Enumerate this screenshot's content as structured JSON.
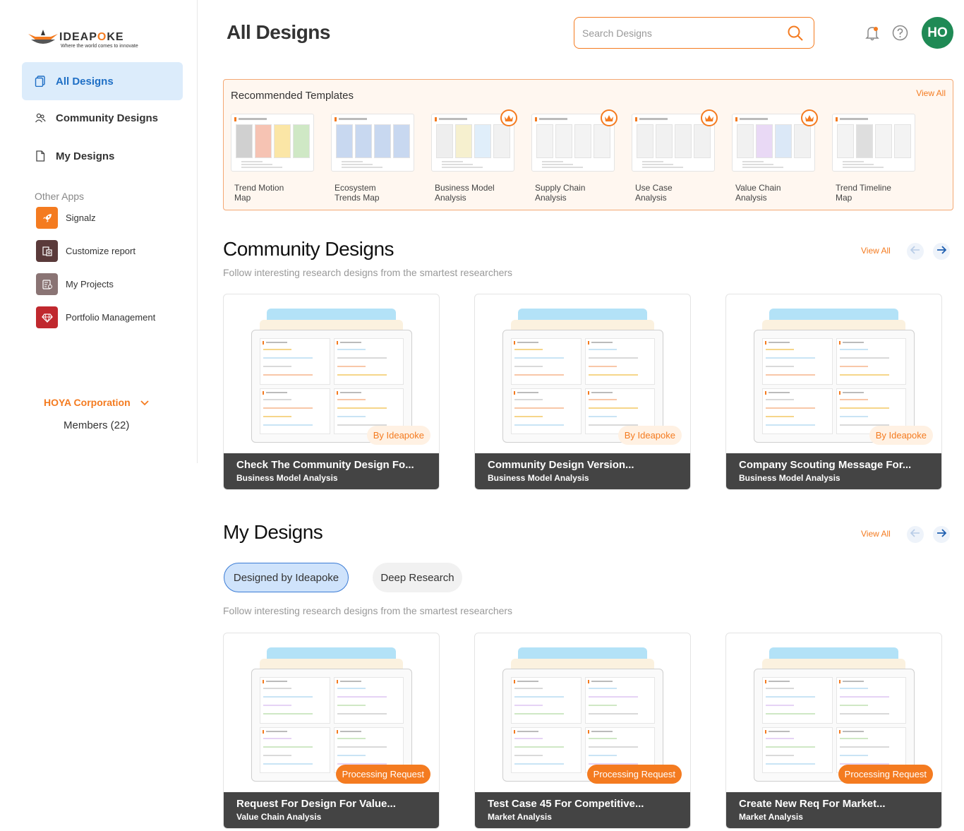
{
  "logo": {
    "word_pre": "IDEAP",
    "word_o": "O",
    "word_post": "KE",
    "tagline": "Where the world comes to innovate"
  },
  "sidebar": {
    "nav": [
      {
        "label": "All Designs"
      },
      {
        "label": "Community Designs"
      },
      {
        "label": "My Designs"
      }
    ],
    "other_apps_label": "Other Apps",
    "apps": [
      {
        "label": "Signalz",
        "color": "#f47b20",
        "icon": "rocket-icon"
      },
      {
        "label": "Customize report",
        "color": "#5a3a3a",
        "icon": "report-icon"
      },
      {
        "label": "My Projects",
        "color": "#8a7474",
        "icon": "projects-icon"
      },
      {
        "label": "Portfolio Management",
        "color": "#c0282e",
        "icon": "diamond-icon"
      }
    ],
    "org": "HOYA Corporation",
    "members": "Members (22)"
  },
  "header": {
    "title": "All Designs",
    "search_placeholder": "Search Designs",
    "avatar_initials": "HO",
    "avatar_color": "#1f8a55"
  },
  "recommended": {
    "title": "Recommended Templates",
    "view_all": "View All",
    "templates": [
      {
        "label": "Trend Motion Map",
        "premium": false
      },
      {
        "label": "Ecosystem Trends Map",
        "premium": false
      },
      {
        "label": "Business Model Analysis",
        "premium": true
      },
      {
        "label": "Supply Chain Analysis",
        "premium": true
      },
      {
        "label": "Use Case Analysis",
        "premium": true
      },
      {
        "label": "Value Chain Analysis",
        "premium": true
      },
      {
        "label": "Trend Timeline Map",
        "premium": false
      }
    ]
  },
  "community": {
    "title": "Community Designs",
    "subtitle": "Follow interesting research designs from the smartest researchers",
    "view_all": "View All",
    "cards": [
      {
        "title": "Check The Community Design Fo...",
        "subtitle": "Business Model Analysis",
        "badge": "By Ideapoke"
      },
      {
        "title": "Community Design Version...",
        "subtitle": "Business Model Analysis",
        "badge": "By Ideapoke"
      },
      {
        "title": "Company Scouting Message For...",
        "subtitle": "Business Model Analysis",
        "badge": "By Ideapoke"
      }
    ]
  },
  "my_designs": {
    "title": "My Designs",
    "view_all": "View All",
    "tabs": [
      {
        "label": "Designed by Ideapoke"
      },
      {
        "label": "Deep Research"
      }
    ],
    "subtitle": "Follow interesting research designs from the smartest researchers",
    "cards": [
      {
        "title": "Request For Design For Value...",
        "subtitle": "Value Chain Analysis",
        "badge": "Processing Request"
      },
      {
        "title": "Test Case 45 For Competitive...",
        "subtitle": "Market Analysis",
        "badge": "Processing Request"
      },
      {
        "title": "Create New Req For Market...",
        "subtitle": "Market Analysis",
        "badge": "Processing Request"
      }
    ]
  },
  "colors": {
    "accent": "#f47b20",
    "active_nav_bg": "#dcecfb",
    "active_nav_text": "#1f6fc5",
    "card_footer": "#444444"
  }
}
